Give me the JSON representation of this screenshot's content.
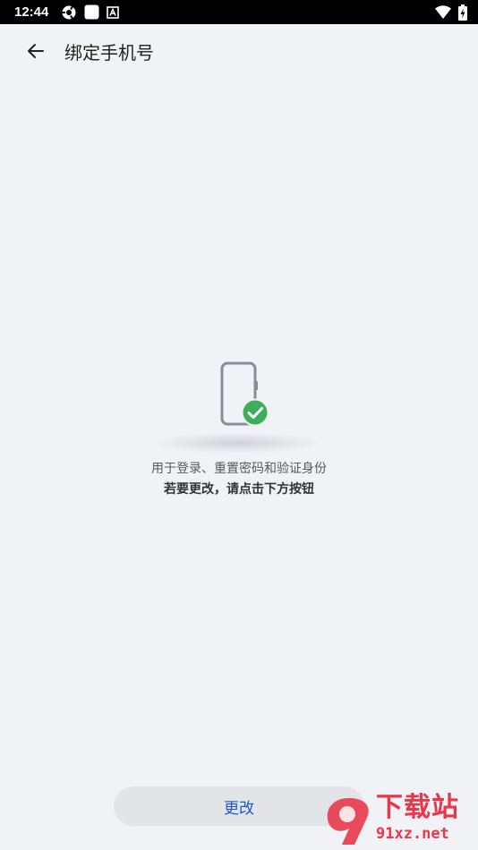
{
  "status_bar": {
    "time": "12:44",
    "left_icons": [
      "settings-gear-icon",
      "white-square-icon",
      "a-box-icon"
    ],
    "right_icons": [
      "wifi-icon",
      "battery-charging-icon"
    ]
  },
  "header": {
    "title": "绑定手机号",
    "back_icon": "arrow-left-icon"
  },
  "main": {
    "illustration_icon": "phone-check-icon",
    "accent_check_color": "#3fae5a",
    "desc_line1": "用于登录、重置密码和验证身份",
    "desc_line2": "若要更改，请点击下方按钮"
  },
  "footer": {
    "change_label": "更改",
    "accent_color": "#1a56d6"
  },
  "watermark": {
    "logo_text": "9",
    "cn_text": "下载站",
    "url_text": "91xz.net"
  }
}
